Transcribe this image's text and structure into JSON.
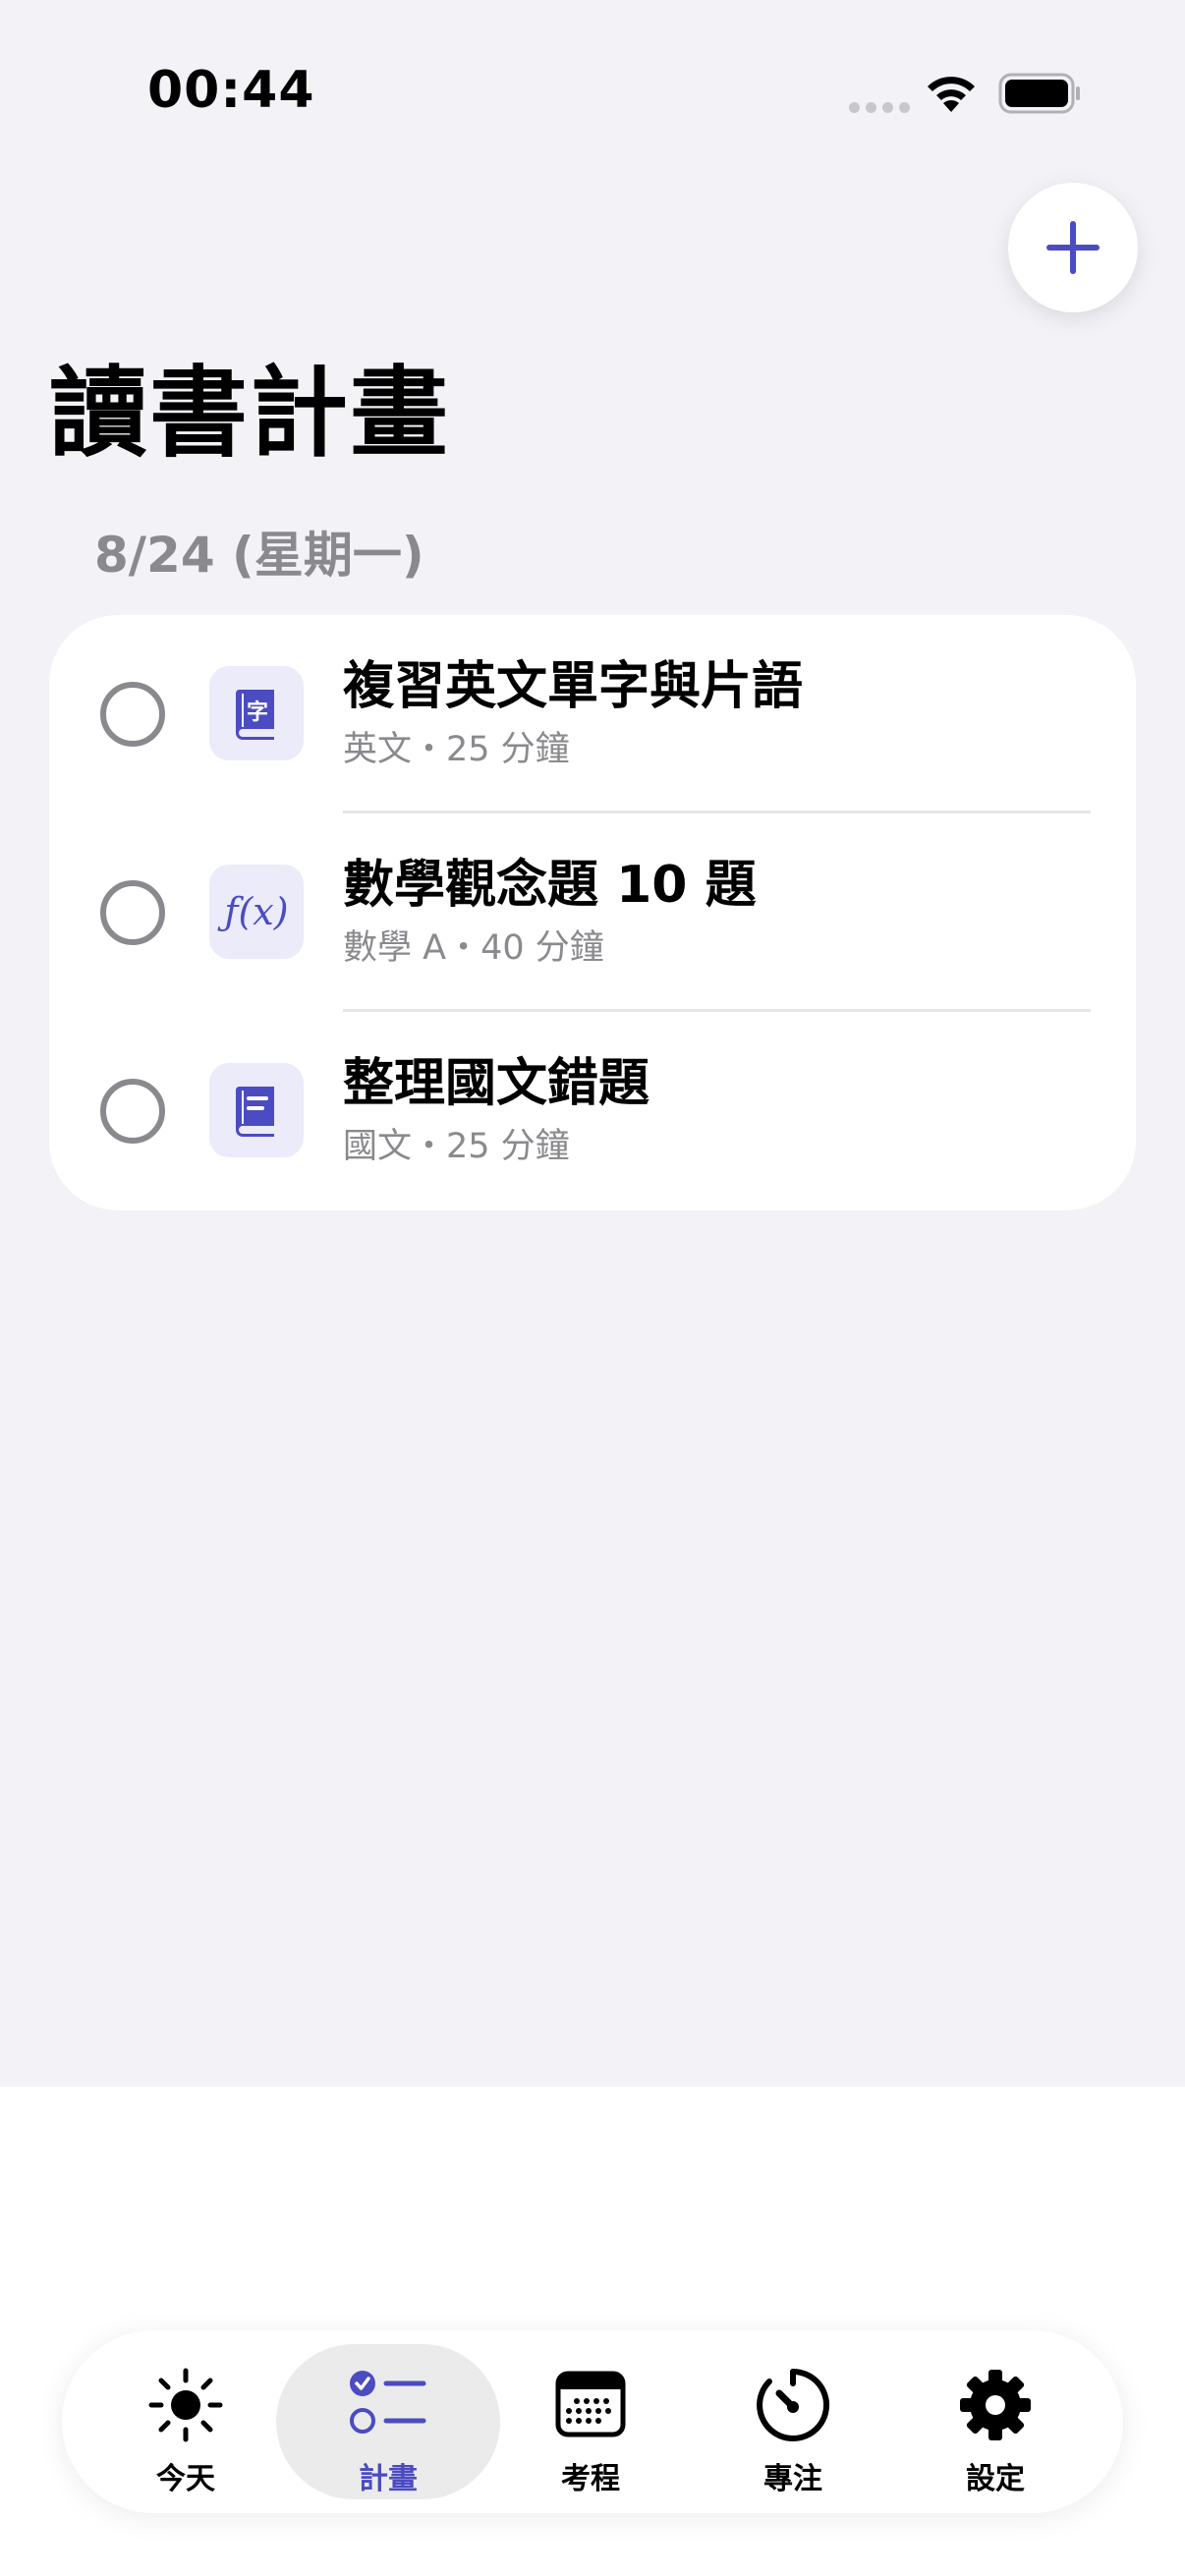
{
  "status_bar": {
    "time": "00:44"
  },
  "page": {
    "title": "讀書計畫",
    "date_header": "8/24 (星期一)"
  },
  "tasks": [
    {
      "title": "複習英文單字與片語",
      "meta": "英文・25 分鐘",
      "icon": "dictionary-book-icon",
      "done": false
    },
    {
      "title": "數學觀念題 10 題",
      "meta": "數學 A・40 分鐘",
      "icon": "function-icon",
      "function_glyph": "ƒ(x)",
      "done": false
    },
    {
      "title": "整理國文錯題",
      "meta": "國文・25 分鐘",
      "icon": "notebook-icon",
      "done": false
    }
  ],
  "tab_bar": {
    "items": [
      {
        "label": "今天",
        "icon": "sun-icon",
        "active": false
      },
      {
        "label": "計畫",
        "icon": "checklist-icon",
        "active": true
      },
      {
        "label": "考程",
        "icon": "calendar-icon",
        "active": false
      },
      {
        "label": "專注",
        "icon": "timer-icon",
        "active": false
      },
      {
        "label": "設定",
        "icon": "gear-icon",
        "active": false
      }
    ]
  },
  "colors": {
    "accent": "#4b4bc2",
    "background": "#f2f2f7",
    "secondary_text": "#8a8a8e",
    "icon_tile": "#ebebfa"
  }
}
